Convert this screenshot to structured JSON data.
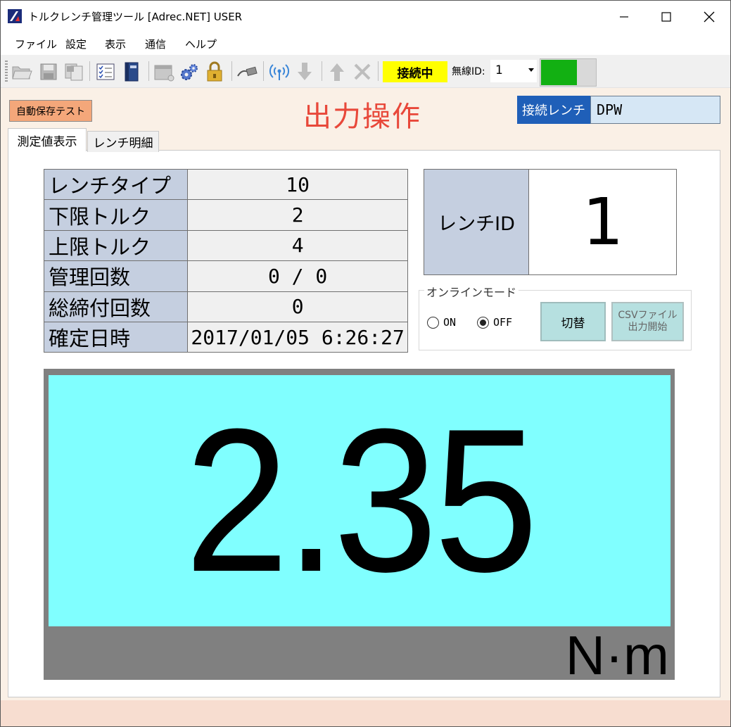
{
  "window": {
    "title": "トルクレンチ管理ツール [Adrec.NET] USER"
  },
  "menu": {
    "file": "ファイル",
    "settings": "設定",
    "view": "表示",
    "comm": "通信",
    "help": "ヘルプ"
  },
  "toolbar": {
    "icons": [
      "open-folder-icon",
      "save-icon",
      "export-icon",
      "checklist-icon",
      "book-icon",
      "window-icon",
      "gears-icon",
      "lock-icon",
      "usb-cable-icon",
      "wireless-icon",
      "download-arrow-icon",
      "upload-arrow-icon",
      "disconnect-icon"
    ],
    "connection_status": "接続中",
    "wireless_id_label": "無線ID:",
    "wireless_id_value": "1",
    "signal_color": "#12b012"
  },
  "header": {
    "auto_save_button": "自動保存テスト",
    "page_title": "出力操作",
    "connected_wrench_label": "接続レンチ",
    "connected_wrench_value": "DPW"
  },
  "tabs": [
    {
      "label": "測定値表示",
      "active": true
    },
    {
      "label": "レンチ明細",
      "active": false
    }
  ],
  "info_table": {
    "rows": [
      {
        "label": "レンチタイプ",
        "value": "10"
      },
      {
        "label": "下限トルク",
        "value": "2"
      },
      {
        "label": "上限トルク",
        "value": "4"
      },
      {
        "label": "管理回数",
        "value": "0 / 0"
      },
      {
        "label": "総締付回数",
        "value": "0"
      },
      {
        "label": "確定日時",
        "value": "2017/01/05 6:26:27"
      }
    ]
  },
  "wrench_id": {
    "label": "レンチID",
    "value": "1"
  },
  "online_mode": {
    "legend": "オンラインモード",
    "on_label": "ON",
    "off_label": "OFF",
    "selected": "OFF",
    "switch_button": "切替",
    "csv_button_line1": "CSVファイル",
    "csv_button_line2": "出力開始"
  },
  "measurement": {
    "value": "2.35",
    "unit": "N·m",
    "display_color": "#80ffff"
  }
}
